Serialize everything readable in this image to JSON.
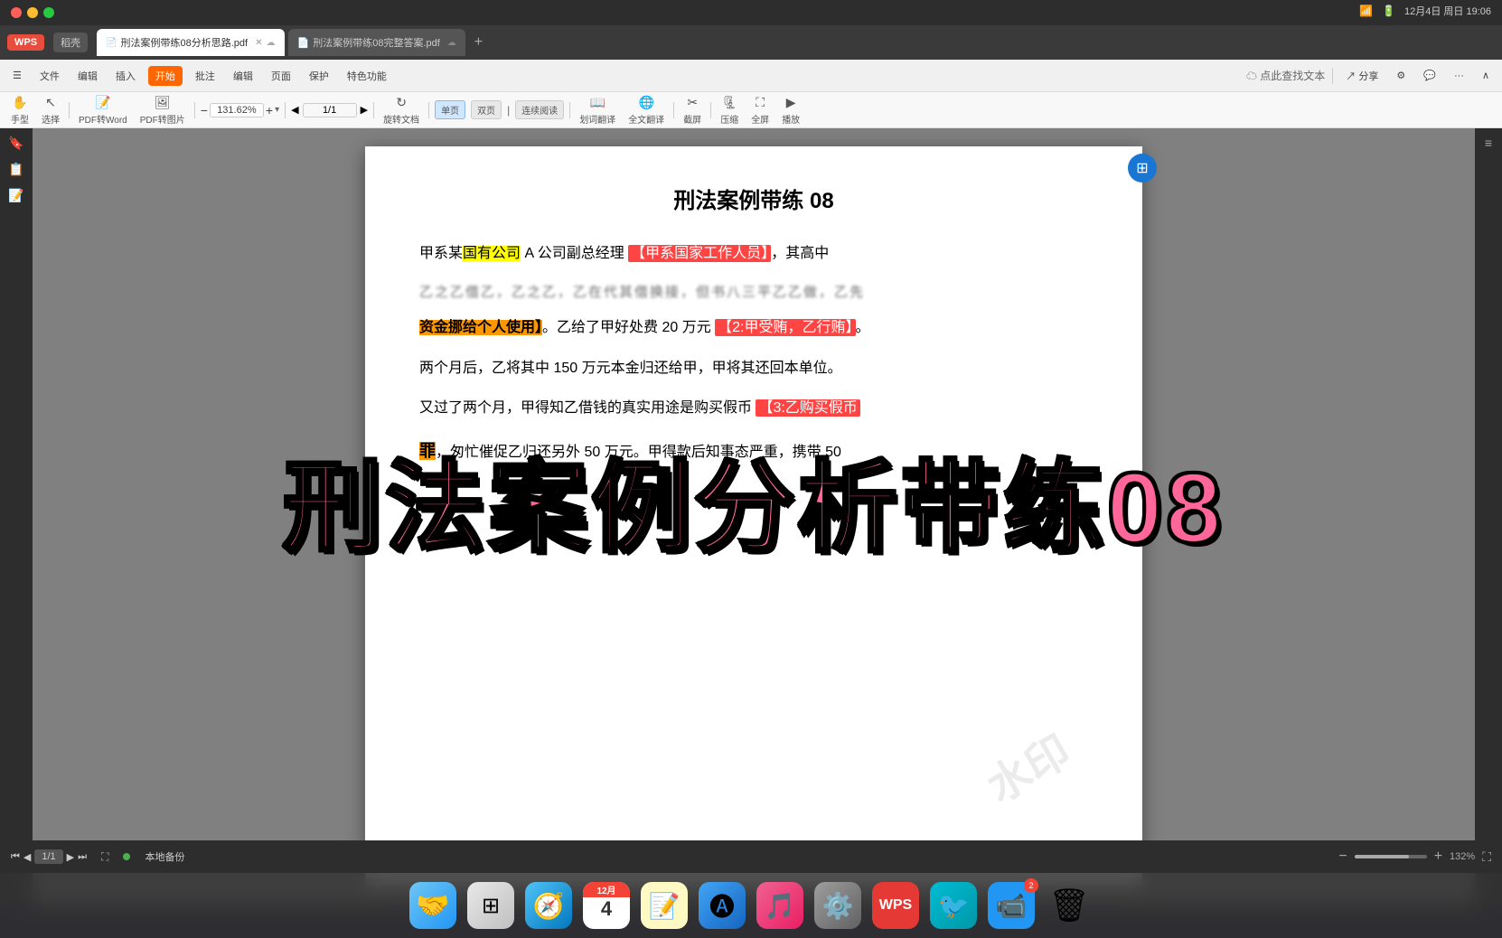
{
  "topbar": {
    "traffic_red": "close",
    "traffic_yellow": "minimize",
    "traffic_green": "maximize",
    "right_time": "12月4日 周日  19:06"
  },
  "tabs": {
    "wps_label": "WPS",
    "shell_label": "稻壳",
    "tab1_label": "刑法案例带练08分析思路.pdf",
    "tab2_label": "刑法案例带练08完整答案.pdf",
    "new_tab": "+"
  },
  "toolbar_row1": {
    "menu_items": [
      "文件",
      "编辑",
      "插入",
      "批注",
      "编辑",
      "页面",
      "保护",
      "特色功能"
    ],
    "active_btn": "开始",
    "search_placeholder": "点此查找文本",
    "share_btn": "分享"
  },
  "toolbar_row2": {
    "hand_tool": "手型",
    "select_tool": "选择",
    "pdf_to_word": "PDF转Word",
    "pdf_to_image": "PDF转图片",
    "zoom_value": "131.62%",
    "rotate_doc": "旋转文档",
    "page_current": "1/1",
    "view_single": "单页",
    "view_double": "双页",
    "view_continuous": "连续阅读",
    "translate_word": "划词翻译",
    "translate_full": "全文翻译",
    "screenshot": "截屏",
    "compress": "压缩",
    "fullscreen": "全屏",
    "play": "播放"
  },
  "pdf_content": {
    "title": "刑法案例带练 08",
    "para1_before": "甲系某",
    "para1_highlight1": "国有公司",
    "para1_middle": " A 公司副总经理 ",
    "para1_highlight2": "【甲系国家工作人员】",
    "para1_after": "，其高中",
    "para1_blurred": "乙之乙借乙，乙之乙，乙在代其借换接，但书八三平乙乙做，乙先",
    "para2_before": "",
    "para2_orange": "资金挪给个人使用】",
    "para2_after": "。乙给了甲好处费 20 万元 ",
    "para2_bracket": "【2:甲受贿，乙行贿】",
    "para2_end": "。",
    "para3": "两个月后，乙将其中 150 万元本金归还给甲，甲将其还回本单位。",
    "para4_before": "又过了两个月，甲得知乙借钱的真实用途是购买假币 ",
    "para4_bracket": "【3:乙购买假币",
    "para5_before": "罪】",
    "para5_highlight": "罪",
    "para5_after": "，匆忙催促乙归还另外 50 万元。甲得款后知事态严重，携带 50"
  },
  "overlay": {
    "title": "刑法案例分析带练08"
  },
  "statusbar": {
    "page_label": "1/1",
    "backup_status": "本地备份",
    "zoom_level": "132%"
  },
  "dock_items": [
    {
      "name": "finder",
      "label": "Finder"
    },
    {
      "name": "launchpad",
      "label": "Launchpad"
    },
    {
      "name": "safari",
      "label": "Safari"
    },
    {
      "name": "calendar",
      "label": "Calendar",
      "day": "4",
      "month": "12月"
    },
    {
      "name": "notes",
      "label": "Notes"
    },
    {
      "name": "appstore",
      "label": "App Store"
    },
    {
      "name": "music",
      "label": "Music"
    },
    {
      "name": "system-settings",
      "label": "System Settings"
    },
    {
      "name": "wps",
      "label": "WPS"
    },
    {
      "name": "feishu",
      "label": "飞书"
    },
    {
      "name": "zoom",
      "label": "Zoom"
    },
    {
      "name": "trash",
      "label": "Trash"
    }
  ]
}
